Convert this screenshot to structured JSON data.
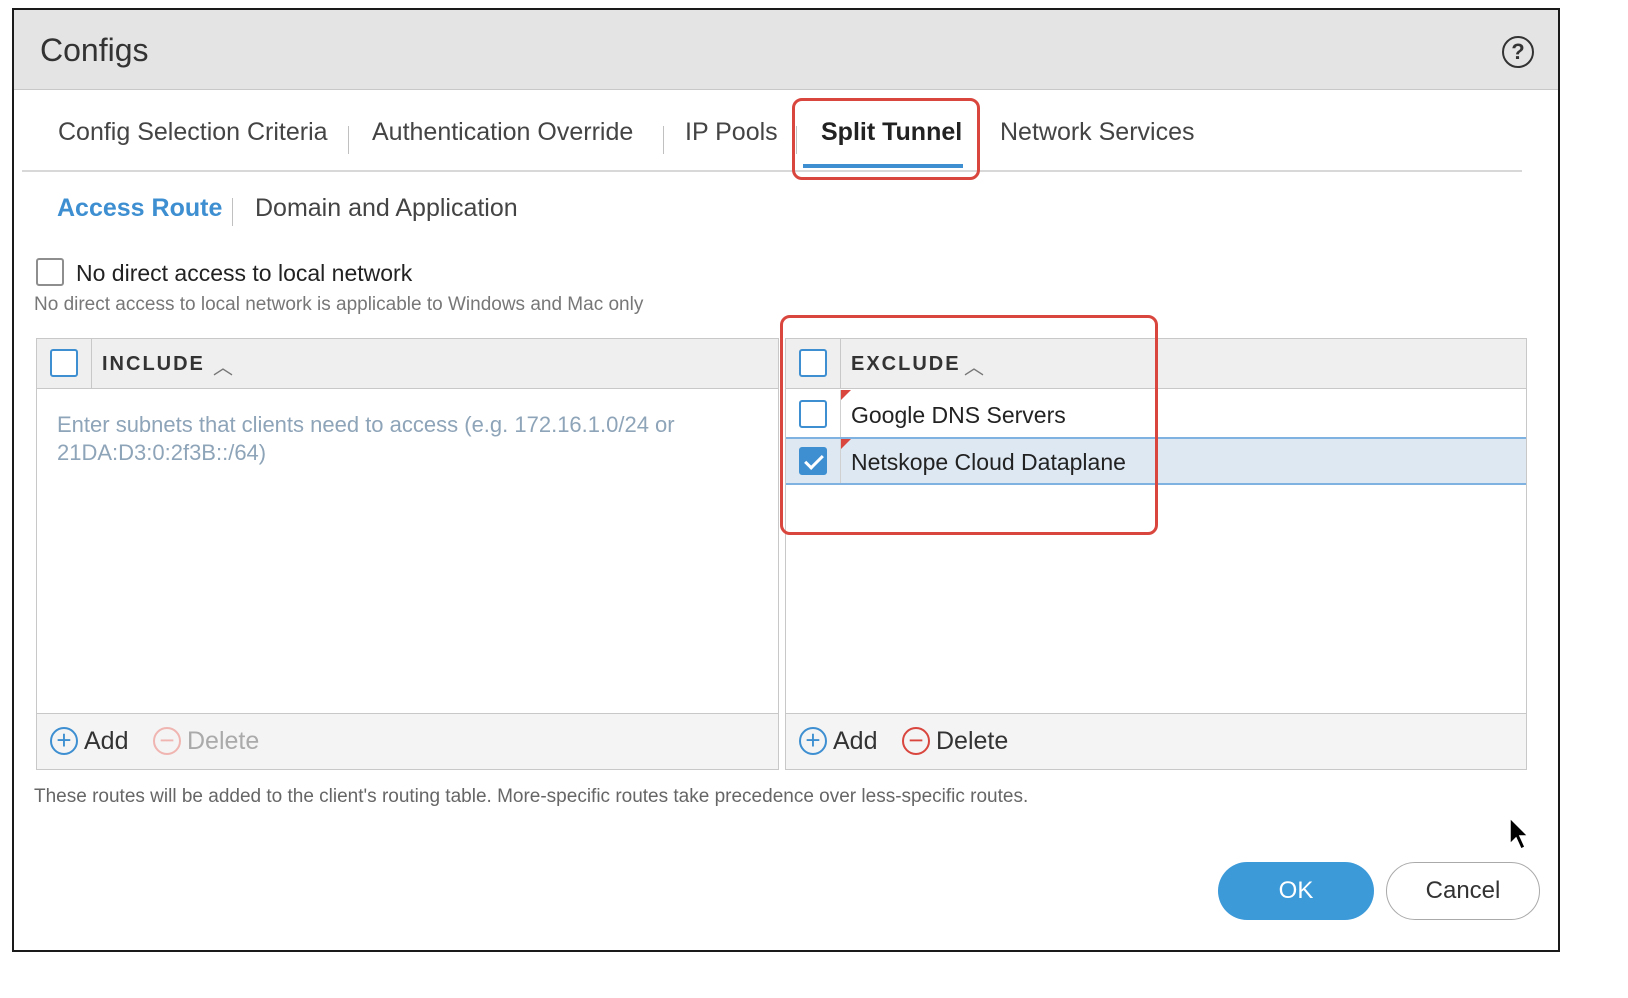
{
  "dialog": {
    "title": "Configs",
    "help_icon": "question-circle-icon"
  },
  "tabs": [
    {
      "label": "Config Selection Criteria",
      "active": false
    },
    {
      "label": "Authentication Override",
      "active": false
    },
    {
      "label": "IP Pools",
      "active": false
    },
    {
      "label": "Split Tunnel",
      "active": true
    },
    {
      "label": "Network Services",
      "active": false
    }
  ],
  "subtabs": [
    {
      "label": "Access Route",
      "active": true
    },
    {
      "label": "Domain and Application",
      "active": false
    }
  ],
  "no_direct_access": {
    "label": "No direct access to local network",
    "checked": false,
    "hint": "No direct access to local network is applicable to Windows and Mac only"
  },
  "include": {
    "header": "INCLUDE",
    "placeholder": "Enter subnets that clients need to access (e.g. 172.16.1.0/24 or 21DA:D3:0:2f3B::/64)",
    "add_label": "Add",
    "delete_label": "Delete",
    "delete_enabled": false
  },
  "exclude": {
    "header": "EXCLUDE",
    "rows": [
      {
        "label": "Google DNS Servers",
        "checked": false
      },
      {
        "label": "Netskope Cloud Dataplane",
        "checked": true
      }
    ],
    "add_label": "Add",
    "delete_label": "Delete",
    "delete_enabled": true
  },
  "note": "These routes will be added to the client's routing table. More-specific routes take precedence over less-specific routes.",
  "buttons": {
    "ok": "OK",
    "cancel": "Cancel"
  },
  "colors": {
    "accent": "#3d8fd1",
    "highlight": "#d9463e"
  }
}
